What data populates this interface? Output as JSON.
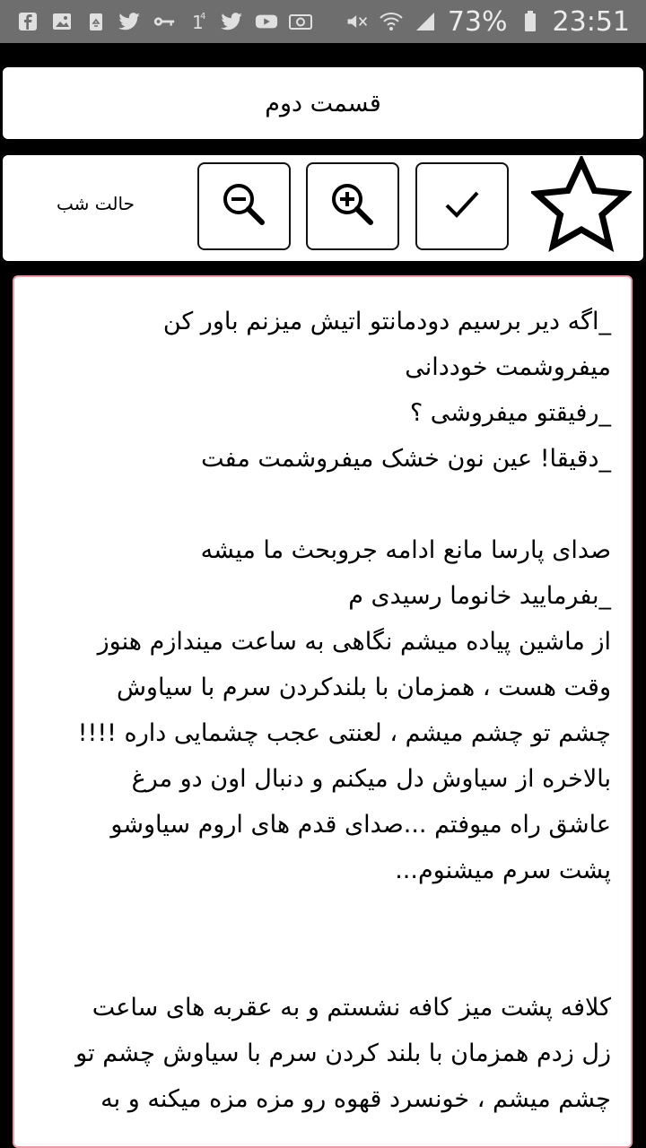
{
  "status_bar": {
    "battery_percent": "73%",
    "time": "23:51",
    "left_icons": [
      "facebook-icon",
      "image-icon",
      "recycle-icon",
      "twitter-icon",
      "key-icon",
      "notification-one-icon",
      "twitter-icon",
      "youtube-icon",
      "voicemail-icon"
    ],
    "right_icons": [
      "mute-icon",
      "wifi-icon",
      "signal-icon",
      "battery-icon"
    ]
  },
  "header": {
    "title": "قسمت دوم"
  },
  "toolbar": {
    "night_mode_label": "حالت شب",
    "buttons": [
      "zoom-out-icon",
      "zoom-in-icon",
      "check-icon",
      "star-icon"
    ]
  },
  "story": {
    "lines": [
      "_اگه دیر برسیم دودمانتو اتیش میزنم باور کن",
      "میفروشمت خوددانی",
      "_رفیقتو میفروشی ؟",
      "_دقیقا! عین نون خشک میفروشمت مفت",
      "",
      "صدای پارسا مانع ادامه جروبحث ما میشه",
      "_بفرمایید خانوما رسیدی م",
      "از ماشین پیاده میشم نگاهی به ساعت میندازم هنوز",
      "وقت هست ، همزمان  با بلندکردن سرم با سیاوش",
      "چشم تو چشم میشم ،  لعنتی عجب چشمایی داره !!!!",
      "بالاخره از سیاوش دل میکنم و دنبال اون دو مرغ",
      "عاشق راه میوفتم ...صدای  قدم های اروم سیاوشو",
      "پشت سرم میشنوم...",
      "",
      "",
      "کلافه پشت میز کافه نشستم و به عقربه های ساعت",
      "زل زدم همزمان با بلند کردن سرم با سیاوش چشم تو",
      "چشم میشم ،  خونسرد قهوه رو مزه مزه میکنه و به"
    ]
  }
}
